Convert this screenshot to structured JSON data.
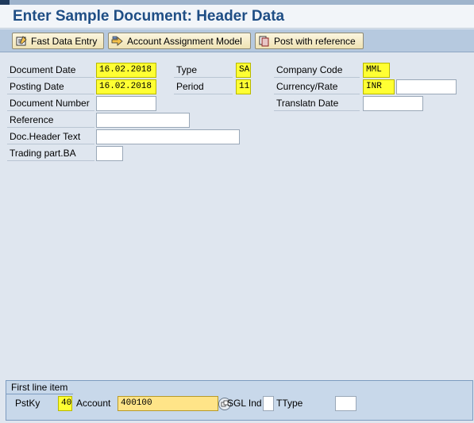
{
  "title": "Enter Sample Document: Header Data",
  "toolbar": {
    "fast_data_entry": "Fast Data Entry",
    "account_assignment_model": "Account Assignment Model",
    "post_with_reference": "Post with reference"
  },
  "header_fields": {
    "document_date": {
      "label": "Document Date",
      "value": "16.02.2018"
    },
    "posting_date": {
      "label": "Posting Date",
      "value": "16.02.2018"
    },
    "document_number": {
      "label": "Document Number",
      "value": ""
    },
    "reference": {
      "label": "Reference",
      "value": ""
    },
    "doc_header_text": {
      "label": "Doc.Header Text",
      "value": ""
    },
    "trading_part_ba": {
      "label": "Trading part.BA",
      "value": ""
    },
    "type": {
      "label": "Type",
      "value": "SA"
    },
    "period": {
      "label": "Period",
      "value": "11"
    },
    "company_code": {
      "label": "Company Code",
      "value": "MML"
    },
    "currency_rate": {
      "label": "Currency/Rate",
      "value": "INR",
      "rate": ""
    },
    "translatn_date": {
      "label": "Translatn Date",
      "value": ""
    }
  },
  "first_line_item": {
    "title": "First line item",
    "pstky": {
      "label": "PstKy",
      "value": "40"
    },
    "account": {
      "label": "Account",
      "value": "400100"
    },
    "sgl_ind": {
      "label": "SGL Ind",
      "value": ""
    },
    "ttype": {
      "label": "TType",
      "value": ""
    }
  },
  "colors": {
    "title": "#1f4e85",
    "required_field": "#ffff33",
    "toolbar_bg": "#b6c9df",
    "background": "#dfe6ef"
  },
  "icons": [
    "fast-data-entry-icon",
    "account-assignment-icon",
    "post-with-reference-icon",
    "possible-entries-icon"
  ]
}
